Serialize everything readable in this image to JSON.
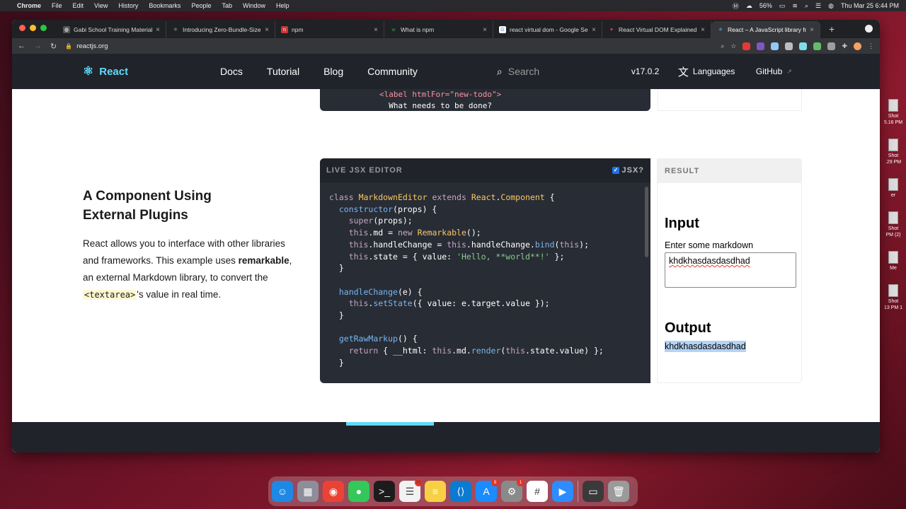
{
  "menubar": {
    "app": "Chrome",
    "items": [
      "File",
      "Edit",
      "View",
      "History",
      "Bookmarks",
      "People",
      "Tab",
      "Window",
      "Help"
    ],
    "battery": "56%",
    "datetime": "Thu Mar 25  6:44 PM"
  },
  "tabs": [
    {
      "title": "Gabi School Training Material",
      "color": "#555"
    },
    {
      "title": "Introducing Zero-Bundle-Size",
      "color": "#61dafb"
    },
    {
      "title": "npm",
      "color": "#cb3837"
    },
    {
      "title": "What is npm",
      "color": "#2ea44f"
    },
    {
      "title": "react virtual dom - Google Se",
      "color": "#4285f4"
    },
    {
      "title": "React Virtual DOM Explained",
      "color": "#e8336a"
    },
    {
      "title": "React – A JavaScript library fo",
      "color": "#61dafb"
    }
  ],
  "address": {
    "url": "reactjs.org"
  },
  "site": {
    "logo": "React",
    "nav": [
      "Docs",
      "Tutorial",
      "Blog",
      "Community"
    ],
    "search_placeholder": "Search",
    "version": "v17.0.2",
    "languages": "Languages",
    "github": "GitHub"
  },
  "prev_editor": {
    "line1_open": "<label htmlFor=\"new-todo\">",
    "line2": "  What needs to be done?"
  },
  "section": {
    "title": "A Component Using External Plugins",
    "body_pre": "React allows you to interface with other libraries and frameworks. This example uses ",
    "body_bold": "remarkable",
    "body_mid": ", an external Markdown library, to convert the ",
    "body_code": "<textarea>",
    "body_post": "'s value in real time."
  },
  "editor": {
    "header": "LIVE JSX EDITOR",
    "jsx_toggle": "JSX?"
  },
  "result": {
    "header": "RESULT",
    "input_heading": "Input",
    "input_label": "Enter some markdown",
    "input_value": "khdkhasdasdasdhad",
    "output_heading": "Output",
    "output_value": "khdkhasdasdasdhad"
  },
  "desktop": [
    {
      "label": "Shot\n5.16 PM"
    },
    {
      "label": "Shot\n.29 PM"
    },
    {
      "label": "er"
    },
    {
      "label": "Shot\nPM (2)"
    },
    {
      "label": "Me"
    },
    {
      "label": "Shot\n13 PM 1"
    }
  ],
  "dock": [
    {
      "name": "finder-icon",
      "color": "#1e88e5",
      "glyph": "☺"
    },
    {
      "name": "launchpad-icon",
      "color": "#8e8e9a",
      "glyph": "▦"
    },
    {
      "name": "chrome-icon",
      "color": "#ea4335",
      "glyph": "◉"
    },
    {
      "name": "messages-icon",
      "color": "#34c759",
      "glyph": "●"
    },
    {
      "name": "terminal-icon",
      "color": "#1c1c1c",
      "glyph": ">_"
    },
    {
      "name": "reminders-icon",
      "color": "#f2f2f2",
      "glyph": "☰",
      "badge": "90"
    },
    {
      "name": "notes-icon",
      "color": "#f7d046",
      "glyph": "≡"
    },
    {
      "name": "vscode-icon",
      "color": "#0b7ad1",
      "glyph": "⟨⟩"
    },
    {
      "name": "appstore-icon",
      "color": "#1a8cff",
      "glyph": "A",
      "badge": "8"
    },
    {
      "name": "system-preferences-icon",
      "color": "#8a8a8a",
      "glyph": "⚙",
      "badge": "1"
    },
    {
      "name": "slack-icon",
      "color": "#ffffff",
      "glyph": "#"
    },
    {
      "name": "zoom-icon",
      "color": "#2d8cff",
      "glyph": "▶"
    },
    {
      "name": "screenshot-icon",
      "color": "#3a3a3a",
      "glyph": "▭"
    },
    {
      "name": "trash-icon",
      "color": "#9a9a9a",
      "glyph": "🗑"
    }
  ]
}
